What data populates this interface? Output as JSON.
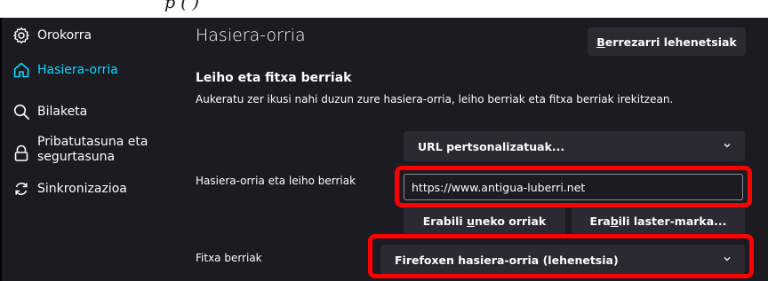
{
  "top_strip_text": "p                              (                   )",
  "sidebar": {
    "items": [
      {
        "label": "Orokorra",
        "icon": "gear-icon",
        "active": false
      },
      {
        "label": "Hasiera-orria",
        "icon": "home-icon",
        "active": true
      },
      {
        "label": "Bilaketa",
        "icon": "search-icon",
        "active": false
      },
      {
        "label": "Pribatutasuna eta segurtasuna",
        "icon": "lock-icon",
        "active": false
      },
      {
        "label": "Sinkronizazioa",
        "icon": "sync-icon",
        "active": false
      }
    ]
  },
  "main": {
    "title": "Hasiera-orria",
    "reset_button": {
      "prefix": "B",
      "rest": "errezarri lehenetsiak"
    },
    "section": {
      "title": "Leiho eta fitxa berriak",
      "description": "Aukeratu zer ikusi nahi duzun zure hasiera-orria, leiho berriak eta fitxa berriak irekitzean."
    },
    "home_windows": {
      "label": "Hasiera-orria eta leiho berriak",
      "select_value": "URL pertsonalizatuak...",
      "url_value": "https://www.antigua-luberri.net",
      "use_current_button": {
        "pre": "Erabili ",
        "accel": "u",
        "post": "neko orriak"
      },
      "use_bookmark_button": {
        "pre": "Era",
        "accel": "b",
        "post": "ili laster-marka..."
      }
    },
    "new_tabs": {
      "label": "Fitxa berriak",
      "select_value": "Firefoxen hasiera-orria (lehenetsia)"
    }
  },
  "colors": {
    "background": "#1c1b22",
    "control": "#2b2a33",
    "accent": "#00ddff",
    "highlight": "#ff0000",
    "text": "#fbfbfe"
  }
}
